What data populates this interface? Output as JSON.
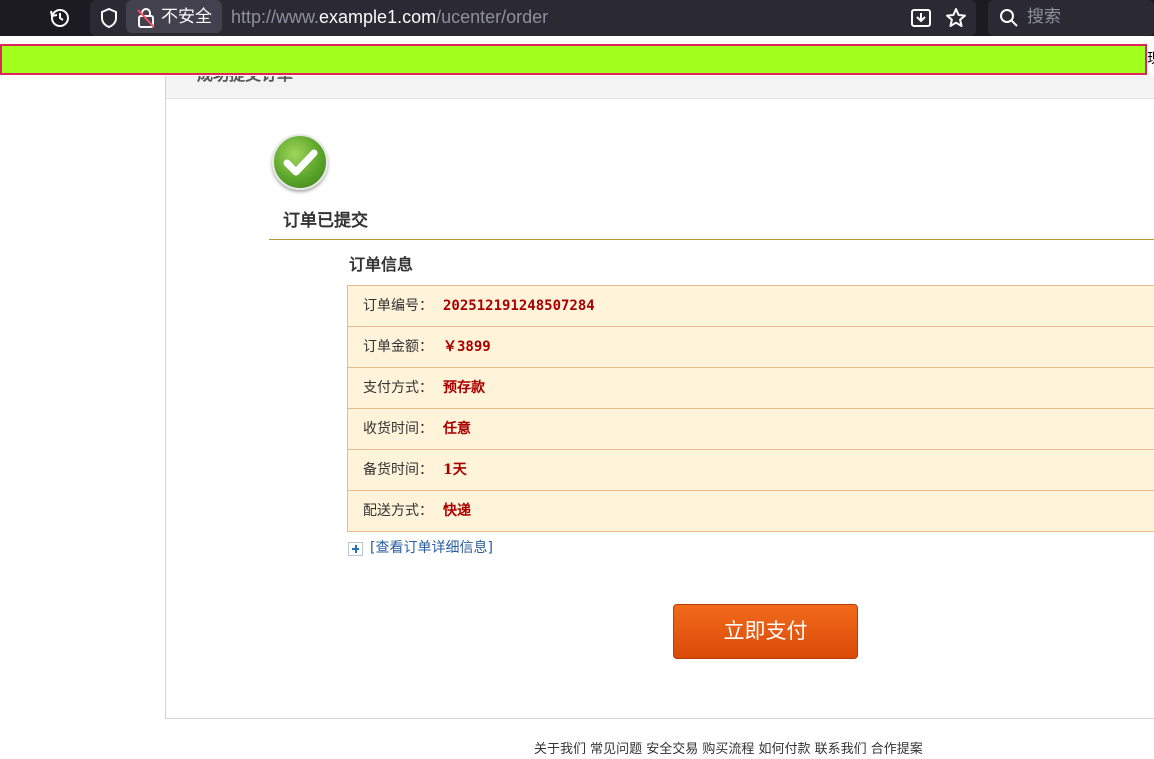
{
  "browser": {
    "security_label": "不安全",
    "url_prefix": "http://www.",
    "url_host": "example1.com",
    "url_path": "/ucenter/order",
    "search_placeholder": "搜索",
    "strip_tail": "现"
  },
  "page": {
    "header_text": "成功提交订单",
    "submitted_title": "订单已提交",
    "info_title": "订单信息",
    "order_rows": [
      {
        "label": "订单编号：",
        "value": "202512191248507284"
      },
      {
        "label": "订单金额：",
        "value": "￥3899"
      },
      {
        "label": "支付方式：",
        "value": "预存款"
      },
      {
        "label": "收货时间：",
        "value": "任意"
      },
      {
        "label": "备货时间：",
        "value": "1天"
      },
      {
        "label": "配送方式：",
        "value": "快递"
      }
    ],
    "detail_link": "[查看订单详细信息]",
    "pay_button": "立即支付",
    "footer_text": "关于我们  常见问题  安全交易  购买流程  如何付款  联系我们  合作提案"
  },
  "colors": {
    "toolbar_bg": "#1c1b22",
    "strip": "#a2ff1d",
    "table_bg": "#fff3d9",
    "value_red": "#a80000",
    "pay_orange": "#e45a0e",
    "link_blue": "#2a5d9f"
  }
}
